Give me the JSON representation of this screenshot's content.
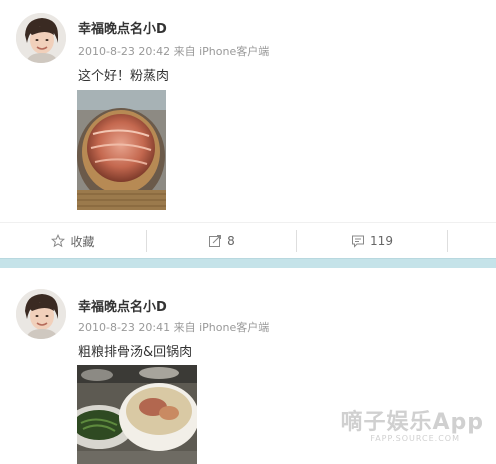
{
  "posts": [
    {
      "username": "幸福晚点名小D",
      "meta": "2010-8-23 20:42 来自 iPhone客户端",
      "text": "这个好！粉蒸肉",
      "actions": {
        "favorite_label": "收藏",
        "repost_count": "8",
        "comment_count": "119"
      }
    },
    {
      "username": "幸福晚点名小D",
      "meta": "2010-8-23 20:41 来自 iPhone客户端",
      "text": "粗粮排骨汤&回锅肉"
    }
  ],
  "watermark": {
    "text": "嘀子娱乐App",
    "sub": "FAPP.SOURCE.COM"
  },
  "colors": {
    "separator": "#c5e3e9",
    "text_primary": "#333333",
    "text_meta": "#999999",
    "action_text": "#666666"
  }
}
